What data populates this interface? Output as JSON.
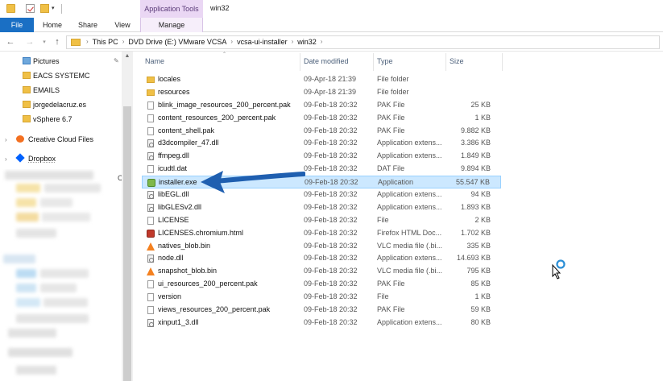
{
  "window": {
    "title": "win32",
    "context_tab_group": "Application Tools"
  },
  "ribbon": {
    "tabs": [
      "File",
      "Home",
      "Share",
      "View",
      "Manage"
    ]
  },
  "address": {
    "crumbs": [
      "This PC",
      "DVD Drive (E:) VMware VCSA",
      "vcsa-ui-installer",
      "win32"
    ]
  },
  "navpane": {
    "items": [
      {
        "label": "Pictures",
        "icon": "pictures-icon",
        "pinned": true
      },
      {
        "label": "EACS SYSTEMC",
        "icon": "folder-icon"
      },
      {
        "label": "EMAILS",
        "icon": "folder-icon"
      },
      {
        "label": "jorgedelacruz.es",
        "icon": "folder-icon"
      },
      {
        "label": "vSphere 6.7",
        "icon": "folder-icon"
      },
      {
        "label": "Creative Cloud Files",
        "icon": "creative-cloud-icon"
      },
      {
        "label": "Dropbox",
        "icon": "dropbox-icon"
      }
    ],
    "partial_marker": "C"
  },
  "columns": {
    "name": "Name",
    "date": "Date modified",
    "type": "Type",
    "size": "Size"
  },
  "files": [
    {
      "name": "locales",
      "date": "09-Apr-18 21:39",
      "type": "File folder",
      "size": "",
      "icon": "folder"
    },
    {
      "name": "resources",
      "date": "09-Apr-18 21:39",
      "type": "File folder",
      "size": "",
      "icon": "folder"
    },
    {
      "name": "blink_image_resources_200_percent.pak",
      "date": "09-Feb-18 20:32",
      "type": "PAK File",
      "size": "25 KB",
      "icon": "file"
    },
    {
      "name": "content_resources_200_percent.pak",
      "date": "09-Feb-18 20:32",
      "type": "PAK File",
      "size": "1 KB",
      "icon": "file"
    },
    {
      "name": "content_shell.pak",
      "date": "09-Feb-18 20:32",
      "type": "PAK File",
      "size": "9.882 KB",
      "icon": "file"
    },
    {
      "name": "d3dcompiler_47.dll",
      "date": "09-Feb-18 20:32",
      "type": "Application extens...",
      "size": "3.386 KB",
      "icon": "dll"
    },
    {
      "name": "ffmpeg.dll",
      "date": "09-Feb-18 20:32",
      "type": "Application extens...",
      "size": "1.849 KB",
      "icon": "dll"
    },
    {
      "name": "icudtl.dat",
      "date": "09-Feb-18 20:32",
      "type": "DAT File",
      "size": "9.894 KB",
      "icon": "file"
    },
    {
      "name": "installer.exe",
      "date": "09-Feb-18 20:32",
      "type": "Application",
      "size": "55.547 KB",
      "icon": "exe",
      "selected": true
    },
    {
      "name": "libEGL.dll",
      "date": "09-Feb-18 20:32",
      "type": "Application extens...",
      "size": "94 KB",
      "icon": "dll"
    },
    {
      "name": "libGLESv2.dll",
      "date": "09-Feb-18 20:32",
      "type": "Application extens...",
      "size": "1.893 KB",
      "icon": "dll"
    },
    {
      "name": "LICENSE",
      "date": "09-Feb-18 20:32",
      "type": "File",
      "size": "2 KB",
      "icon": "file"
    },
    {
      "name": "LICENSES.chromium.html",
      "date": "09-Feb-18 20:32",
      "type": "Firefox HTML Doc...",
      "size": "1.702 KB",
      "icon": "firefox"
    },
    {
      "name": "natives_blob.bin",
      "date": "09-Feb-18 20:32",
      "type": "VLC media file (.bi...",
      "size": "335 KB",
      "icon": "vlc"
    },
    {
      "name": "node.dll",
      "date": "09-Feb-18 20:32",
      "type": "Application extens...",
      "size": "14.693 KB",
      "icon": "dll"
    },
    {
      "name": "snapshot_blob.bin",
      "date": "09-Feb-18 20:32",
      "type": "VLC media file (.bi...",
      "size": "795 KB",
      "icon": "vlc"
    },
    {
      "name": "ui_resources_200_percent.pak",
      "date": "09-Feb-18 20:32",
      "type": "PAK File",
      "size": "85 KB",
      "icon": "file"
    },
    {
      "name": "version",
      "date": "09-Feb-18 20:32",
      "type": "File",
      "size": "1 KB",
      "icon": "file"
    },
    {
      "name": "views_resources_200_percent.pak",
      "date": "09-Feb-18 20:32",
      "type": "PAK File",
      "size": "59 KB",
      "icon": "file"
    },
    {
      "name": "xinput1_3.dll",
      "date": "09-Feb-18 20:32",
      "type": "Application extens...",
      "size": "80 KB",
      "icon": "dll"
    }
  ],
  "colors": {
    "file_tab": "#1a6fc4",
    "context_tab": "#ead7f4",
    "selection": "#cce8ff",
    "arrow": "#1f5fb0"
  }
}
